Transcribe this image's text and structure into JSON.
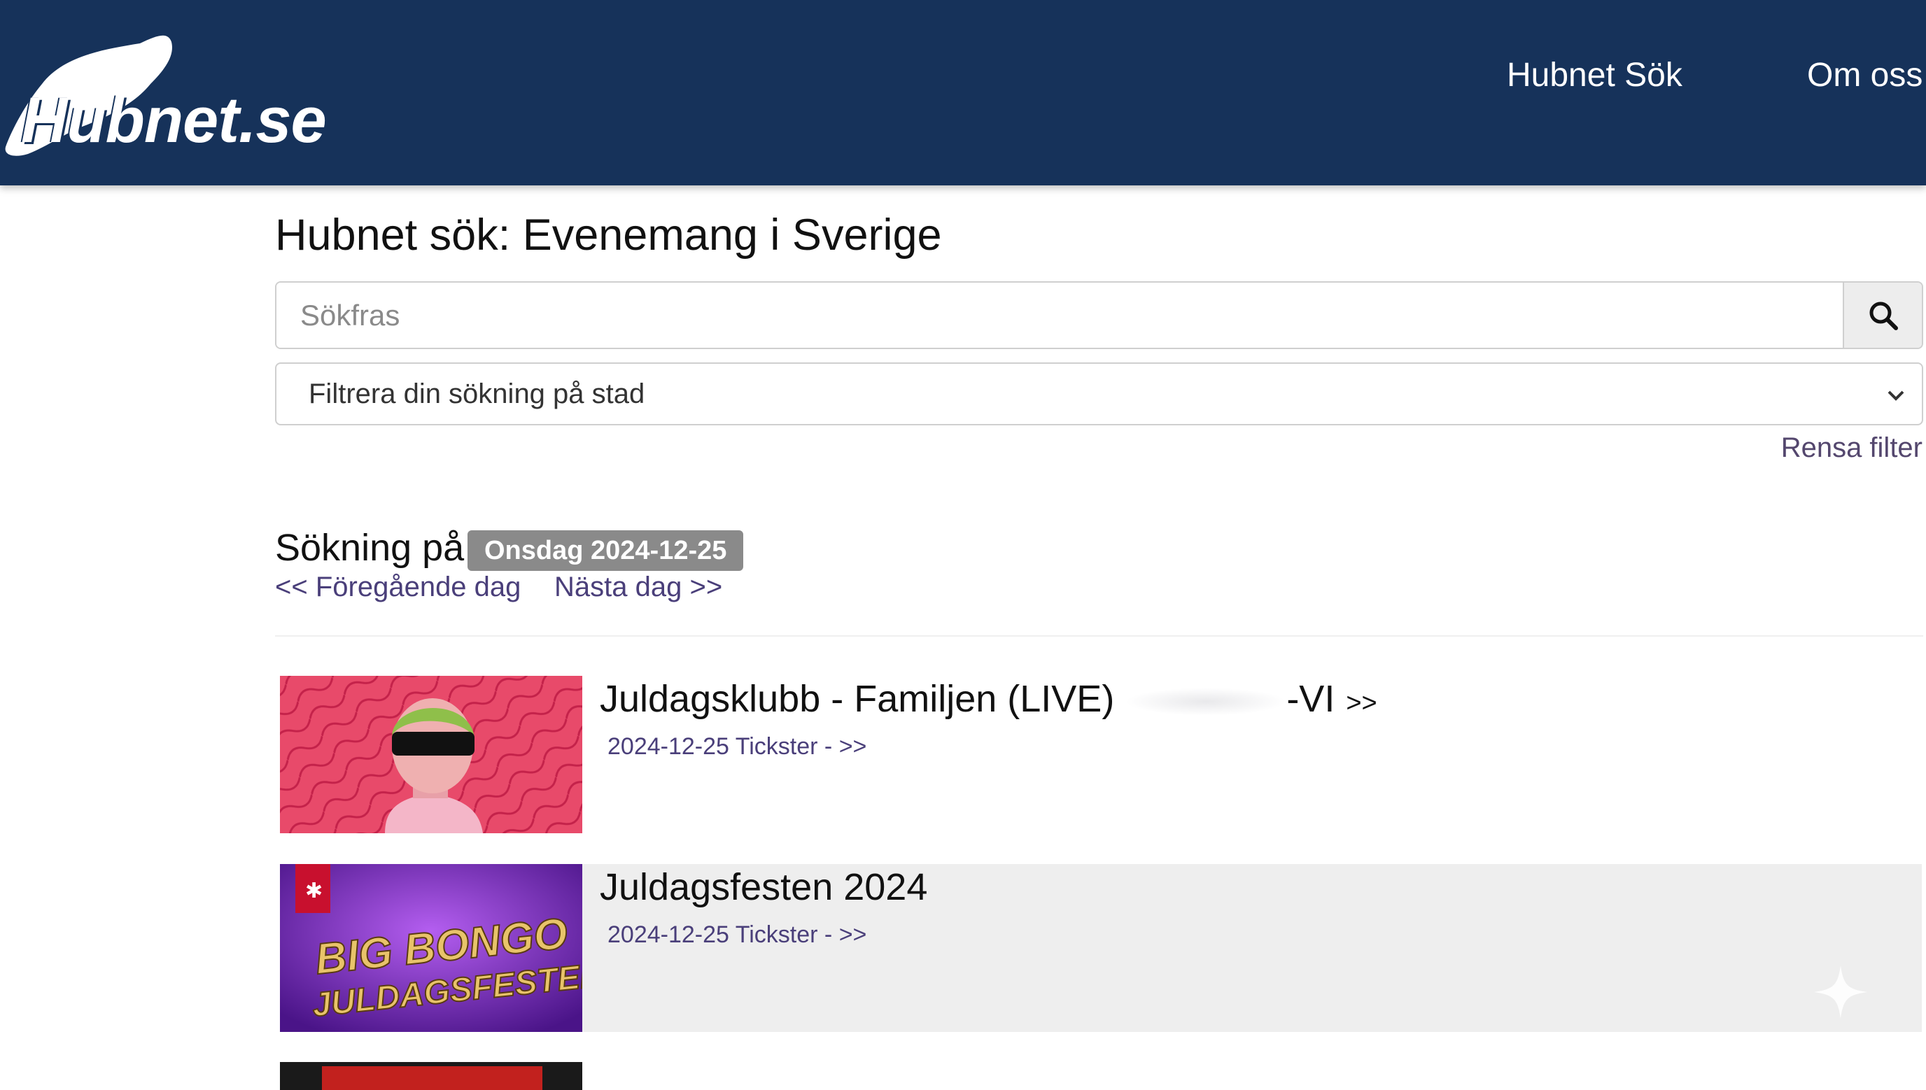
{
  "header": {
    "logo_text": "Hubnet.se",
    "nav": [
      {
        "label": "Hubnet Sök"
      },
      {
        "label": "Om oss"
      }
    ],
    "bg_color": "#16325a"
  },
  "main": {
    "title": "Hubnet sök: Evenemang i Sverige",
    "search": {
      "placeholder": "Sökfras",
      "value": "",
      "button_icon": "search-icon"
    },
    "city_filter": {
      "selected": "Filtrera din sökning på stad",
      "icon": "chevron-down-icon"
    },
    "clear_filter_label": "Rensa filter",
    "search_on_label": "Sökning på",
    "date_badge": "Onsdag 2024-12-25",
    "prev_day_label": "<< Föregående dag",
    "next_day_label": "Nästa dag >>"
  },
  "events": [
    {
      "title": "Juldagsklubb - Familjen (LIVE)",
      "title_tail": "-VI",
      "arrow": ">>",
      "meta": "2024-12-25 Tickster - >>"
    },
    {
      "title": "Juldagsfesten 2024",
      "meta": "2024-12-25 Tickster - >>",
      "thumb_text_line1": "BIG BONGO",
      "thumb_text_line2": "JULDAGSFESTEN"
    }
  ],
  "colors": {
    "link": "#4a3f7a",
    "badge": "#8a8a8a",
    "alt_row": "#eeeeee"
  }
}
